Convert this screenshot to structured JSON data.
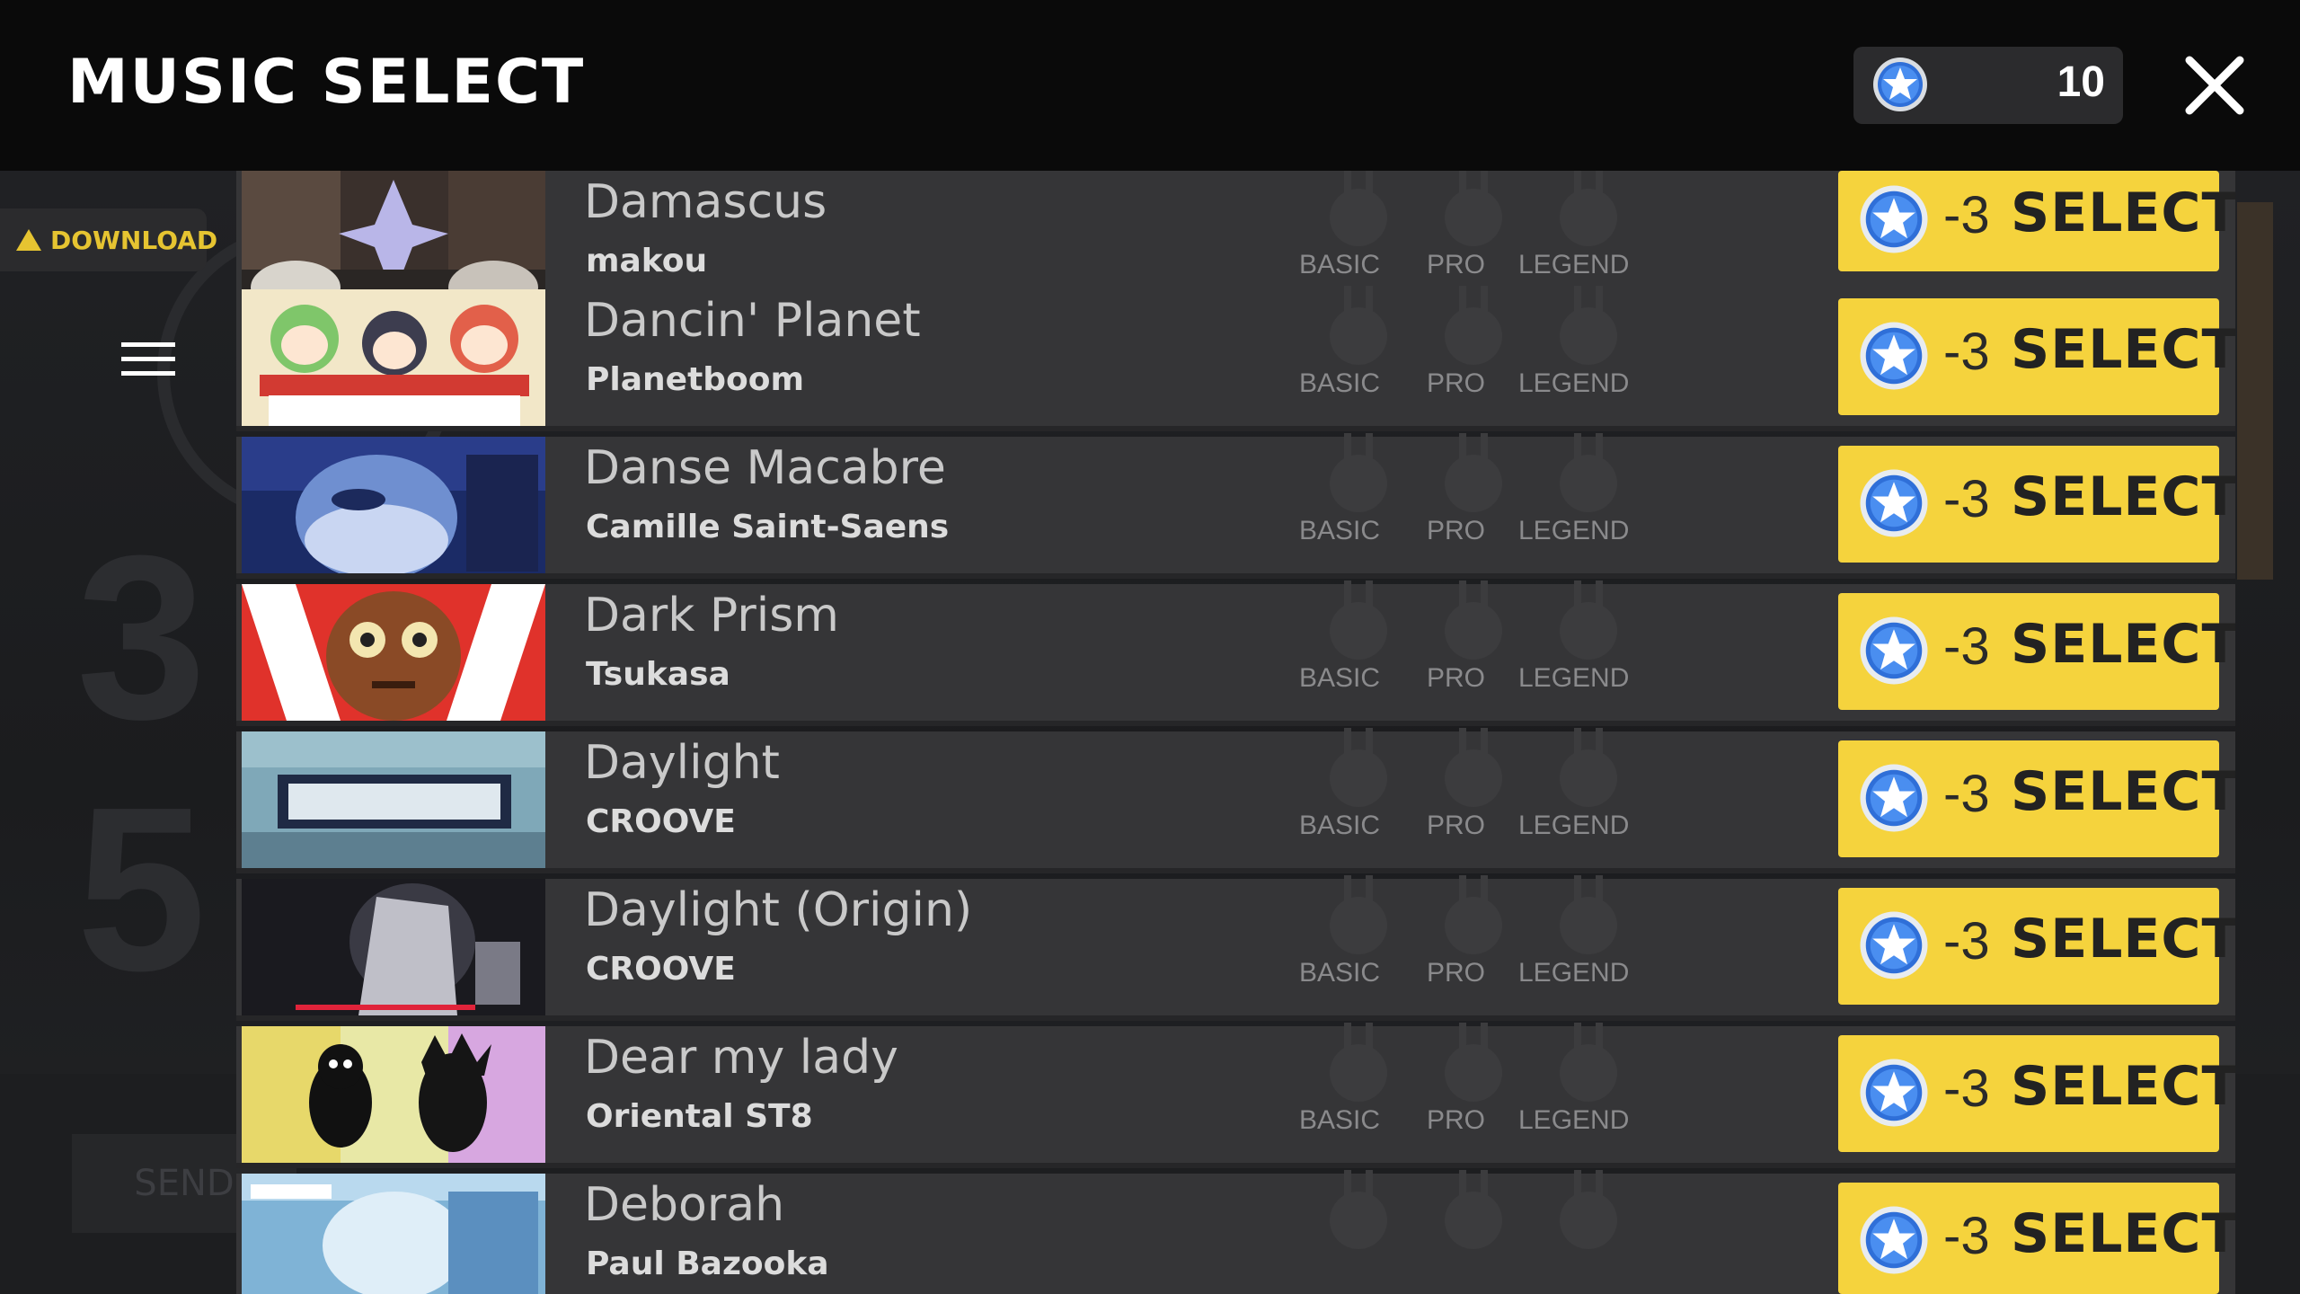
{
  "header": {
    "title": "MUSIC SELECT",
    "credits": "10"
  },
  "sidebar": {
    "download_label": "DOWNLOAD"
  },
  "difficulty_labels": {
    "basic": "BASIC",
    "pro": "PRO",
    "legend": "LEGEND"
  },
  "select_button": {
    "cost": "-3",
    "label": "SELECT"
  },
  "background": {
    "send_label": "SEND"
  },
  "songs": [
    {
      "title": "Damascus",
      "artist": "makou"
    },
    {
      "title": "Dancin' Planet",
      "artist": "Planetboom"
    },
    {
      "title": "Danse Macabre",
      "artist": "Camille Saint-Saens"
    },
    {
      "title": "Dark Prism",
      "artist": "Tsukasa"
    },
    {
      "title": "Daylight",
      "artist": "CROOVE"
    },
    {
      "title": "Daylight (Origin)",
      "artist": "CROOVE"
    },
    {
      "title": "Dear my lady",
      "artist": "Oriental ST8"
    },
    {
      "title": "Deborah",
      "artist": "Paul Bazooka"
    }
  ],
  "colors": {
    "accent": "#f5d33d",
    "row_bg": "#353537",
    "header_bg": "#0a0a0a",
    "download": "#e6c431"
  }
}
